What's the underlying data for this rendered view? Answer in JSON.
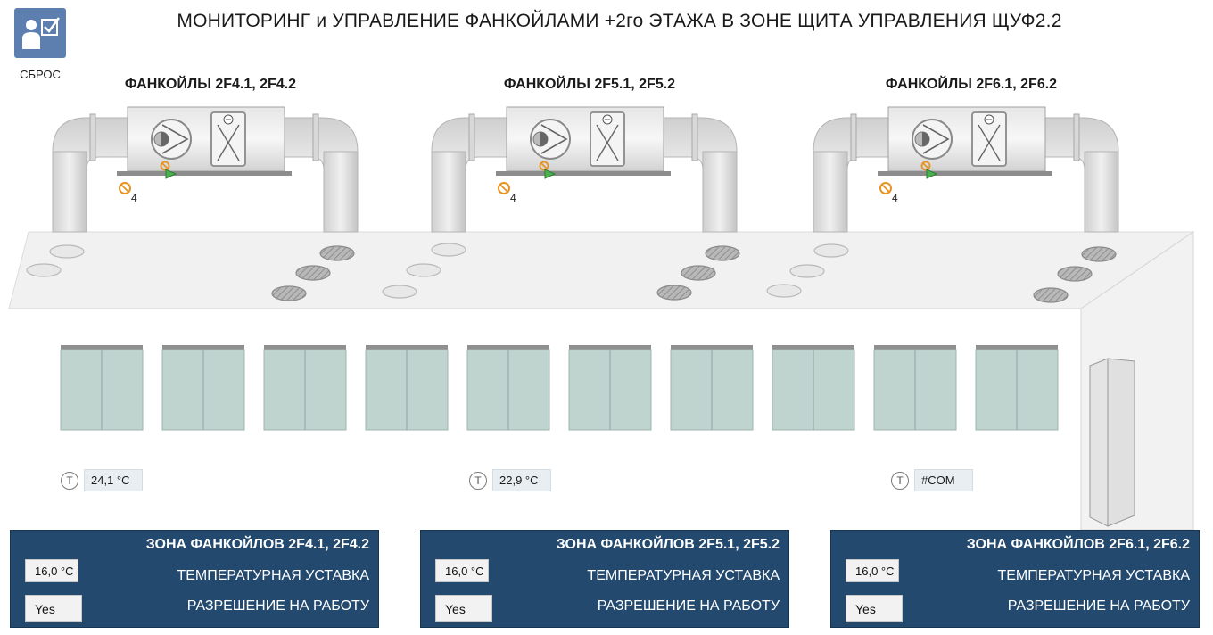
{
  "title": "МОНИТОРИНГ и УПРАВЛЕНИЕ ФАНКОЙЛАМИ +2го ЭТАЖА В ЗОНЕ ЩИТА УПРАВЛЕНИЯ ЩУФ2.2",
  "reset": {
    "label": "СБРОС",
    "icon": "user-checklist-icon"
  },
  "units": [
    {
      "title": "ФАНКОЙЛЫ 2F4.1, 2F4.2",
      "fan_icon": "fan-icon",
      "filter_icon": "filter-icon",
      "alarm_count": "4"
    },
    {
      "title": "ФАНКОЙЛЫ 2F5.1, 2F5.2",
      "fan_icon": "fan-icon",
      "filter_icon": "filter-icon",
      "alarm_count": "4"
    },
    {
      "title": "ФАНКОЙЛЫ 2F6.1, 2F6.2",
      "fan_icon": "fan-icon",
      "filter_icon": "filter-icon",
      "alarm_count": "4"
    }
  ],
  "probes": [
    {
      "symbol": "T",
      "value": "24,1 °C"
    },
    {
      "symbol": "T",
      "value": "22,9 °C"
    },
    {
      "symbol": "T",
      "value": "#COM"
    }
  ],
  "zones": [
    {
      "title": "ЗОНА ФАНКОЙЛОВ 2F4.1, 2F4.2",
      "setpoint_value": "16,0 °C",
      "setpoint_label": "ТЕМПЕРАТУРНАЯ УСТАВКА",
      "enable_value": "Yes",
      "enable_label": "РАЗРЕШЕНИЕ НА РАБОТУ"
    },
    {
      "title": "ЗОНА ФАНКОЙЛОВ 2F5.1, 2F5.2",
      "setpoint_value": "16,0 °C",
      "setpoint_label": "ТЕМПЕРАТУРНАЯ УСТАВКА",
      "enable_value": "Yes",
      "enable_label": "РАЗРЕШЕНИЕ НА РАБОТУ"
    },
    {
      "title": "ЗОНА ФАНКОЙЛОВ 2F6.1, 2F6.2",
      "setpoint_value": "16,0 °C",
      "setpoint_label": "ТЕМПЕРАТУРНАЯ УСТАВКА",
      "enable_value": "Yes",
      "enable_label": "РАЗРЕШЕНИЕ НА РАБОТУ"
    }
  ],
  "colors": {
    "panel_bg": "#234a6e",
    "reset_bg": "#5d7fb0",
    "window": "#bfd3cf",
    "status_ok": "#4caf50",
    "alarm": "#e89320"
  }
}
